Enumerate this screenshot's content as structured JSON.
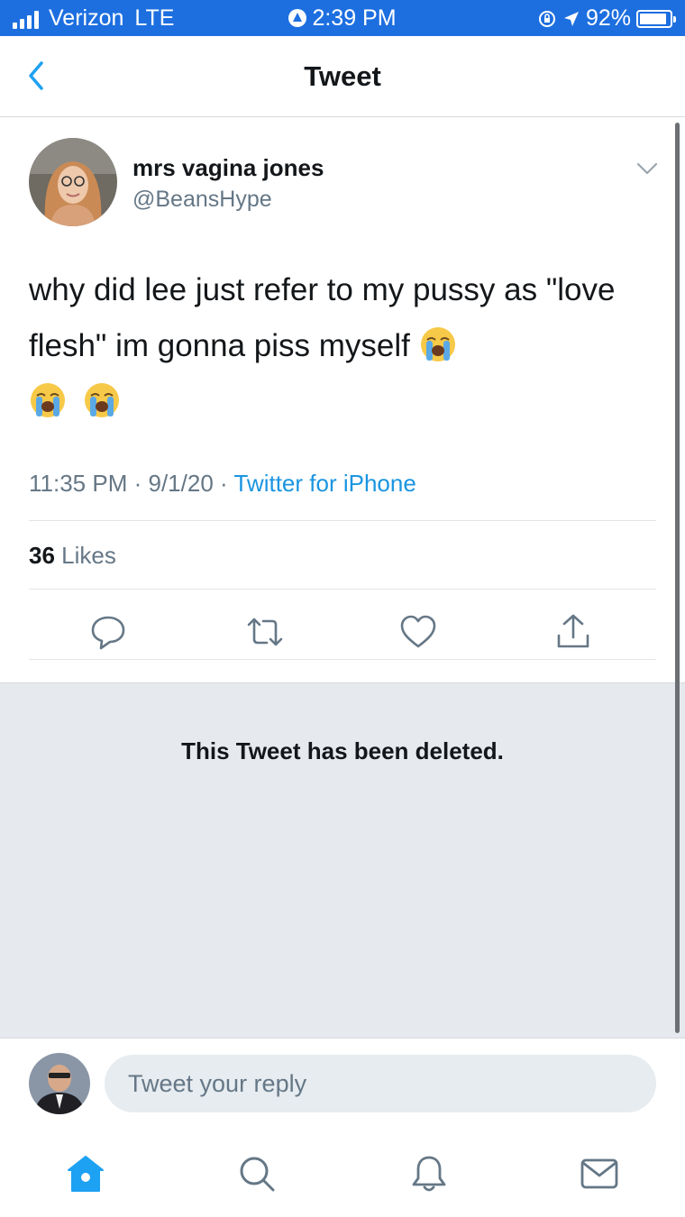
{
  "status_bar": {
    "carrier": "Verizon",
    "network": "LTE",
    "time": "2:39 PM",
    "battery": "92%",
    "battery_level": 0.92,
    "icons": [
      "signal-icon",
      "location-icon",
      "lock-rotation-icon",
      "location-arrow-icon",
      "battery-charging-icon"
    ]
  },
  "nav": {
    "title": "Tweet",
    "back_icon": "chevron-left-icon"
  },
  "tweet": {
    "display_name": "mrs vagina jones",
    "handle": "@BeansHype",
    "text": "why did lee just refer to my pussy as \"love flesh\" im gonna piss myself",
    "emojis": [
      "loudly-crying-face",
      "loudly-crying-face",
      "loudly-crying-face"
    ],
    "time": "11:35 PM",
    "date": "9/1/20",
    "separator": "·",
    "source": "Twitter for iPhone",
    "likes_count": "36",
    "likes_label": "Likes",
    "actions": [
      "reply-icon",
      "retweet-icon",
      "like-icon",
      "share-icon"
    ]
  },
  "deleted": {
    "message": "This Tweet has been deleted."
  },
  "reply": {
    "placeholder": "Tweet your reply"
  },
  "tab_bar": {
    "tabs": [
      "home-icon",
      "search-icon",
      "notifications-icon",
      "messages-icon"
    ],
    "active": "home-icon"
  },
  "colors": {
    "status_bar": "#1d6fe0",
    "accent": "#1da1f2",
    "link": "#1b95e0",
    "secondary_text": "#657786",
    "deleted_bg": "#e6e9ee"
  }
}
